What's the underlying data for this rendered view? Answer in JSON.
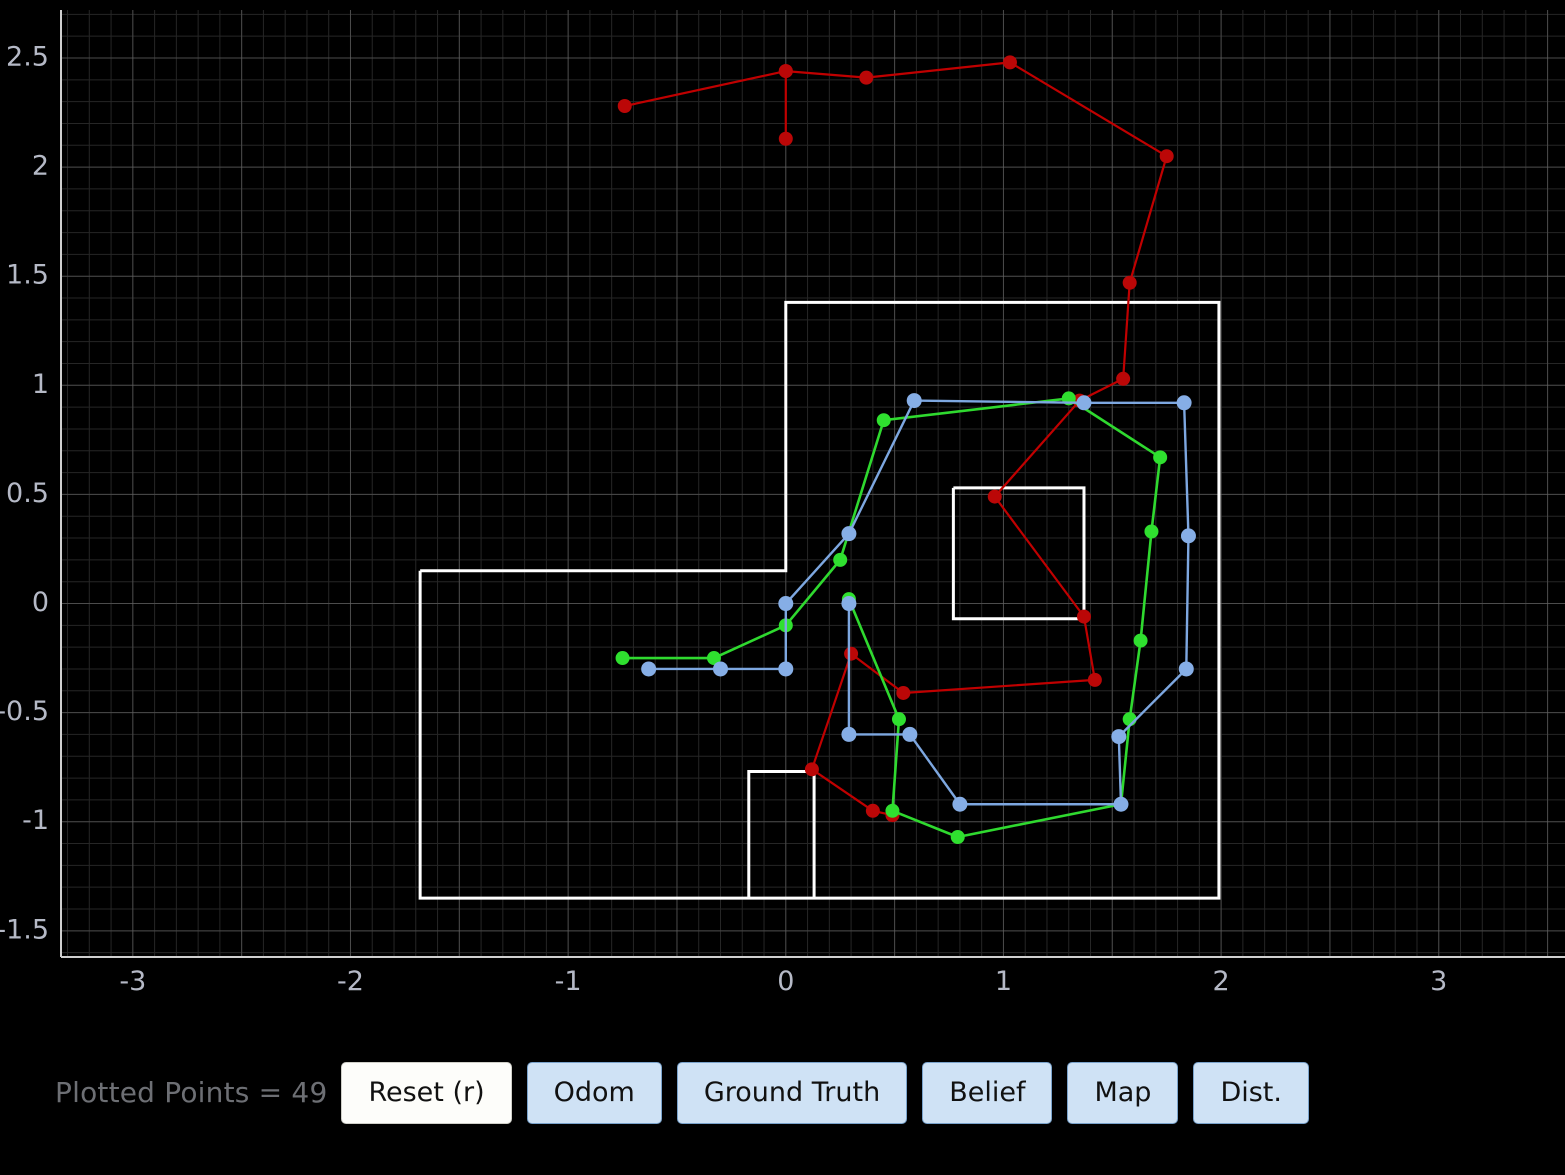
{
  "toolbar": {
    "status_text": "Plotted Points = 49",
    "buttons": [
      {
        "label": "Reset (r)",
        "state": "active"
      },
      {
        "label": "Odom",
        "state": "toggle"
      },
      {
        "label": "Ground Truth",
        "state": "toggle"
      },
      {
        "label": "Belief",
        "state": "toggle"
      },
      {
        "label": "Map",
        "state": "toggle"
      },
      {
        "label": "Dist.",
        "state": "toggle"
      }
    ]
  },
  "chart_data": {
    "type": "line",
    "title": "",
    "xlabel": "",
    "ylabel": "",
    "xlim": [
      -3.33,
      3.58
    ],
    "ylim": [
      -1.62,
      2.72
    ],
    "xticks": [
      -3,
      -2,
      -1,
      0,
      1,
      2,
      3
    ],
    "yticks": [
      -1.5,
      -1,
      -0.5,
      0,
      0.5,
      1,
      1.5,
      2,
      2.5
    ],
    "xticklabels": [
      "-3",
      "-2",
      "-1",
      "0",
      "1",
      "2",
      "3"
    ],
    "yticklabels": [
      "-1.5",
      "-1",
      "-0.5",
      "0",
      "0.5",
      "1",
      "1.5",
      "2",
      "2.5"
    ],
    "grid": true,
    "grid_minor_step": 0.1,
    "grid_major_step": 0.5,
    "legend": "none",
    "background": "#000000",
    "grid_color_minor": "#262626",
    "grid_color_major": "#6b6b6b",
    "axis_color": "#cfcfcf",
    "tick_label_color": "#b5b9c6",
    "series": [
      {
        "name": "Odom",
        "color": "#c00000",
        "marker_color": "#bb0707",
        "linewidth": 2.2,
        "markersize": 9,
        "points": [
          [
            -0.74,
            2.28
          ],
          [
            0.0,
            2.44
          ],
          [
            0.0,
            2.13
          ],
          [
            0.0,
            2.44
          ],
          [
            0.37,
            2.41
          ],
          [
            1.03,
            2.48
          ],
          [
            1.75,
            2.05
          ],
          [
            1.58,
            1.47
          ],
          [
            1.55,
            1.03
          ],
          [
            1.35,
            0.93
          ],
          [
            0.96,
            0.49
          ],
          [
            1.37,
            -0.06
          ],
          [
            1.42,
            -0.35
          ],
          [
            0.54,
            -0.41
          ],
          [
            0.3,
            -0.23
          ],
          [
            0.12,
            -0.76
          ],
          [
            0.4,
            -0.95
          ],
          [
            0.49,
            -0.97
          ]
        ]
      },
      {
        "name": "Ground Truth",
        "color": "#2fd92f",
        "marker_color": "#2fe02f",
        "linewidth": 2.6,
        "markersize": 9,
        "points": [
          [
            -0.75,
            -0.25
          ],
          [
            -0.33,
            -0.25
          ],
          [
            0.0,
            -0.1
          ],
          [
            0.25,
            0.2
          ],
          [
            0.45,
            0.84
          ],
          [
            1.3,
            0.94
          ],
          [
            1.72,
            0.67
          ],
          [
            1.68,
            0.33
          ],
          [
            1.63,
            -0.17
          ],
          [
            1.58,
            -0.53
          ],
          [
            1.54,
            -0.92
          ],
          [
            0.79,
            -1.07
          ],
          [
            0.49,
            -0.95
          ],
          [
            0.52,
            -0.53
          ],
          [
            0.29,
            0.02
          ]
        ]
      },
      {
        "name": "Belief",
        "color": "#7da7e0",
        "marker_color": "#86aee6",
        "linewidth": 2.4,
        "markersize": 10,
        "points": [
          [
            -0.63,
            -0.3
          ],
          [
            -0.3,
            -0.3
          ],
          [
            0.0,
            -0.3
          ],
          [
            0.0,
            0.0
          ],
          [
            0.29,
            0.32
          ],
          [
            0.59,
            0.93
          ],
          [
            1.37,
            0.92
          ],
          [
            1.83,
            0.92
          ],
          [
            1.85,
            0.31
          ],
          [
            1.84,
            -0.3
          ],
          [
            1.53,
            -0.61
          ],
          [
            1.54,
            -0.92
          ],
          [
            0.8,
            -0.92
          ],
          [
            0.57,
            -0.6
          ],
          [
            0.29,
            -0.6
          ],
          [
            0.29,
            0.0
          ]
        ]
      }
    ],
    "map": {
      "name": "Map",
      "color": "#ffffff",
      "linewidth": 3,
      "polylines": [
        [
          [
            -1.68,
            0.15
          ],
          [
            0.0,
            0.15
          ],
          [
            0.0,
            1.38
          ],
          [
            1.99,
            1.38
          ],
          [
            1.99,
            -1.35
          ],
          [
            -1.68,
            -1.35
          ],
          [
            -1.68,
            0.15
          ]
        ],
        [
          [
            0.77,
            0.53
          ],
          [
            1.37,
            0.53
          ],
          [
            1.37,
            -0.07
          ],
          [
            0.77,
            -0.07
          ],
          [
            0.77,
            0.53
          ]
        ],
        [
          [
            -0.17,
            -1.35
          ],
          [
            -0.17,
            -0.77
          ],
          [
            0.13,
            -0.77
          ],
          [
            0.13,
            -1.35
          ]
        ]
      ]
    }
  }
}
